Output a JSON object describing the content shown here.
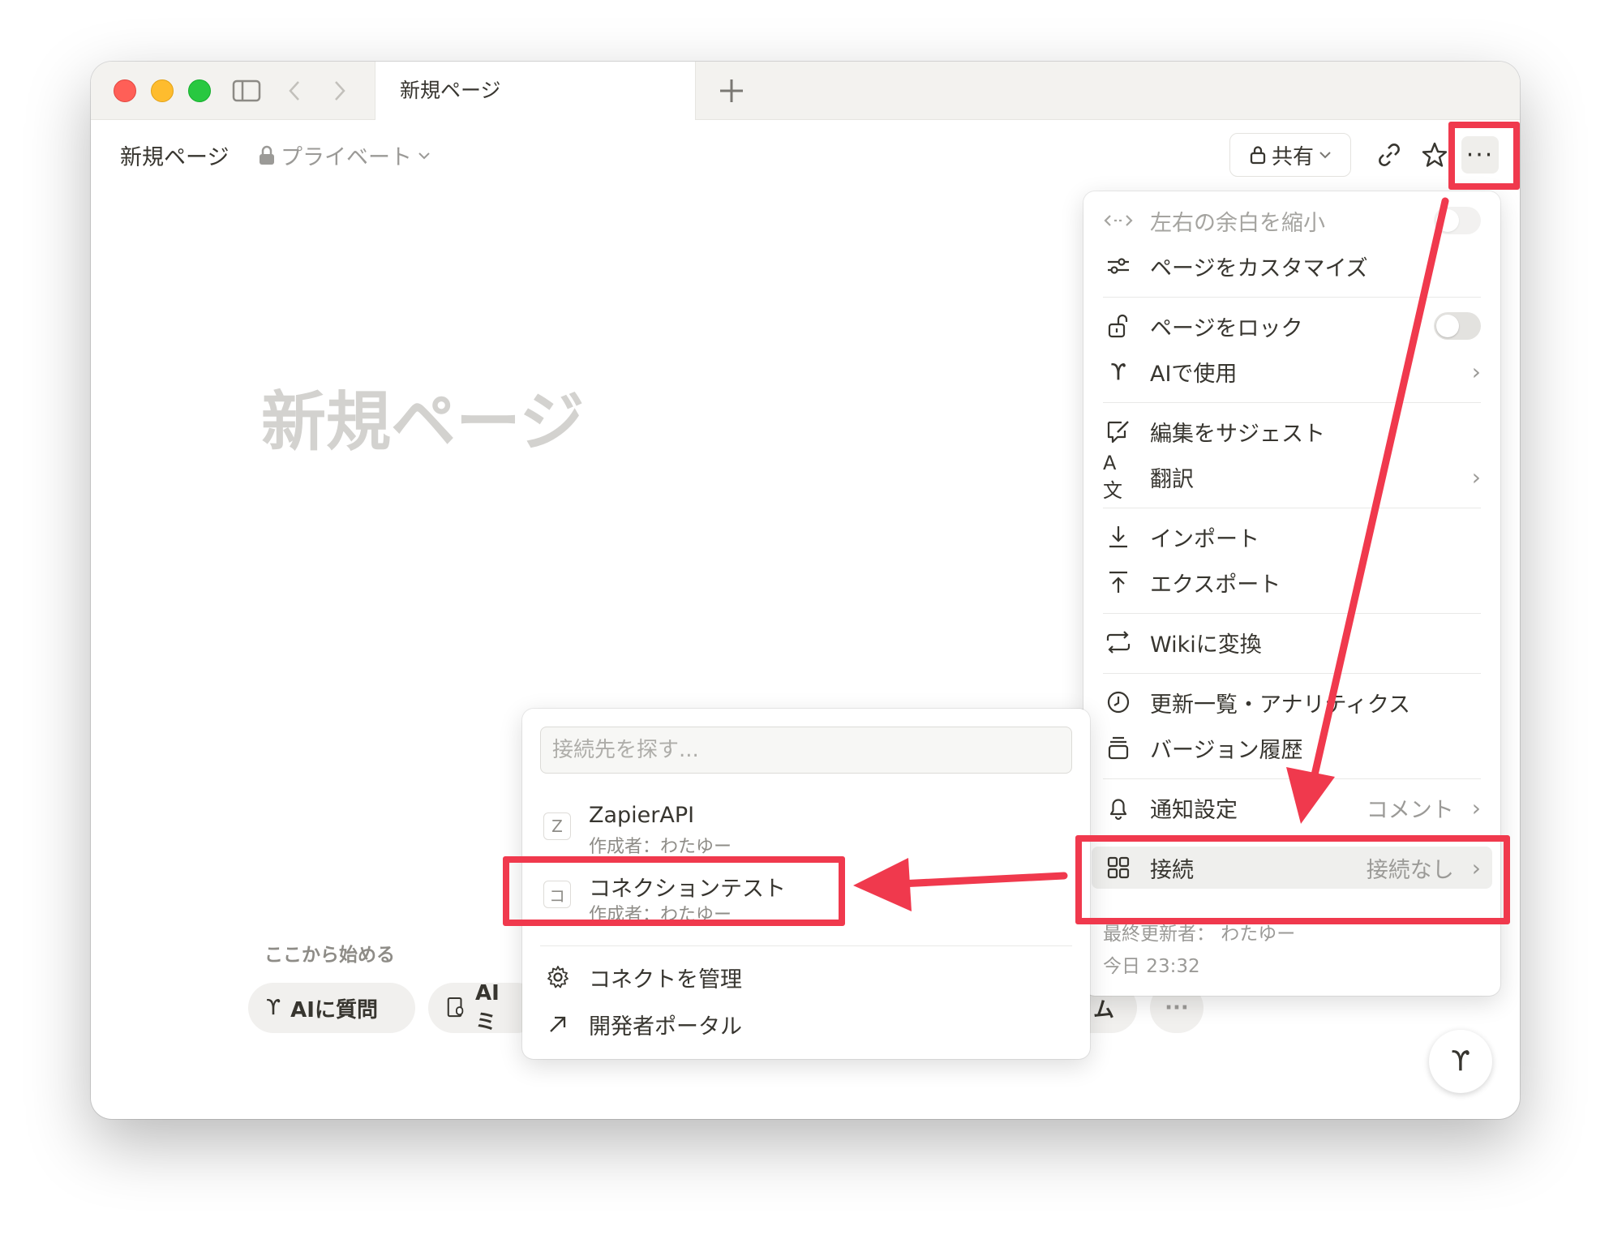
{
  "window": {
    "tab_title": "新規ページ",
    "new_tab_label": "+"
  },
  "header": {
    "breadcrumb": "新規ページ",
    "privacy_label": "プライベート",
    "share_label": "共有",
    "more_label": "···"
  },
  "page": {
    "title_placeholder": "新規ページ",
    "start_label": "ここから始める",
    "chips": [
      {
        "label": "AIに質問",
        "icon": "ai-icon"
      },
      {
        "label": "AI ミ",
        "icon": "meeting-icon"
      },
      {
        "label": "ム"
      },
      {
        "label": "···"
      }
    ]
  },
  "menu": {
    "items": {
      "narrow": "左右の余白を縮小",
      "customize": "ページをカスタマイズ",
      "lock": "ページをロック",
      "use_ai": "AIで使用",
      "suggest": "編集をサジェスト",
      "translate": "翻訳",
      "translate_icon": "A文",
      "import": "インポート",
      "export": "エクスポート",
      "wiki": "Wikiに変換",
      "analytics": "更新一覧・アナリティクス",
      "version": "バージョン履歴",
      "notify": "通知設定",
      "notify_value": "コメント",
      "connect": "接続",
      "connect_value": "接続なし"
    },
    "last_edited": "最終更新者： わたゆー",
    "last_edited_time": "今日 23:32"
  },
  "submenu": {
    "search_placeholder": "接続先を探す...",
    "connections": [
      {
        "badge": "Z",
        "name": "ZapierAPI",
        "author": "作成者：わたゆー"
      },
      {
        "badge": "コ",
        "name": "コネクションテスト",
        "author": "作成者：わたゆー"
      }
    ],
    "manage": "コネクトを管理",
    "developer": "開発者ポータル"
  },
  "annotations": {
    "color": "#f0394d"
  }
}
